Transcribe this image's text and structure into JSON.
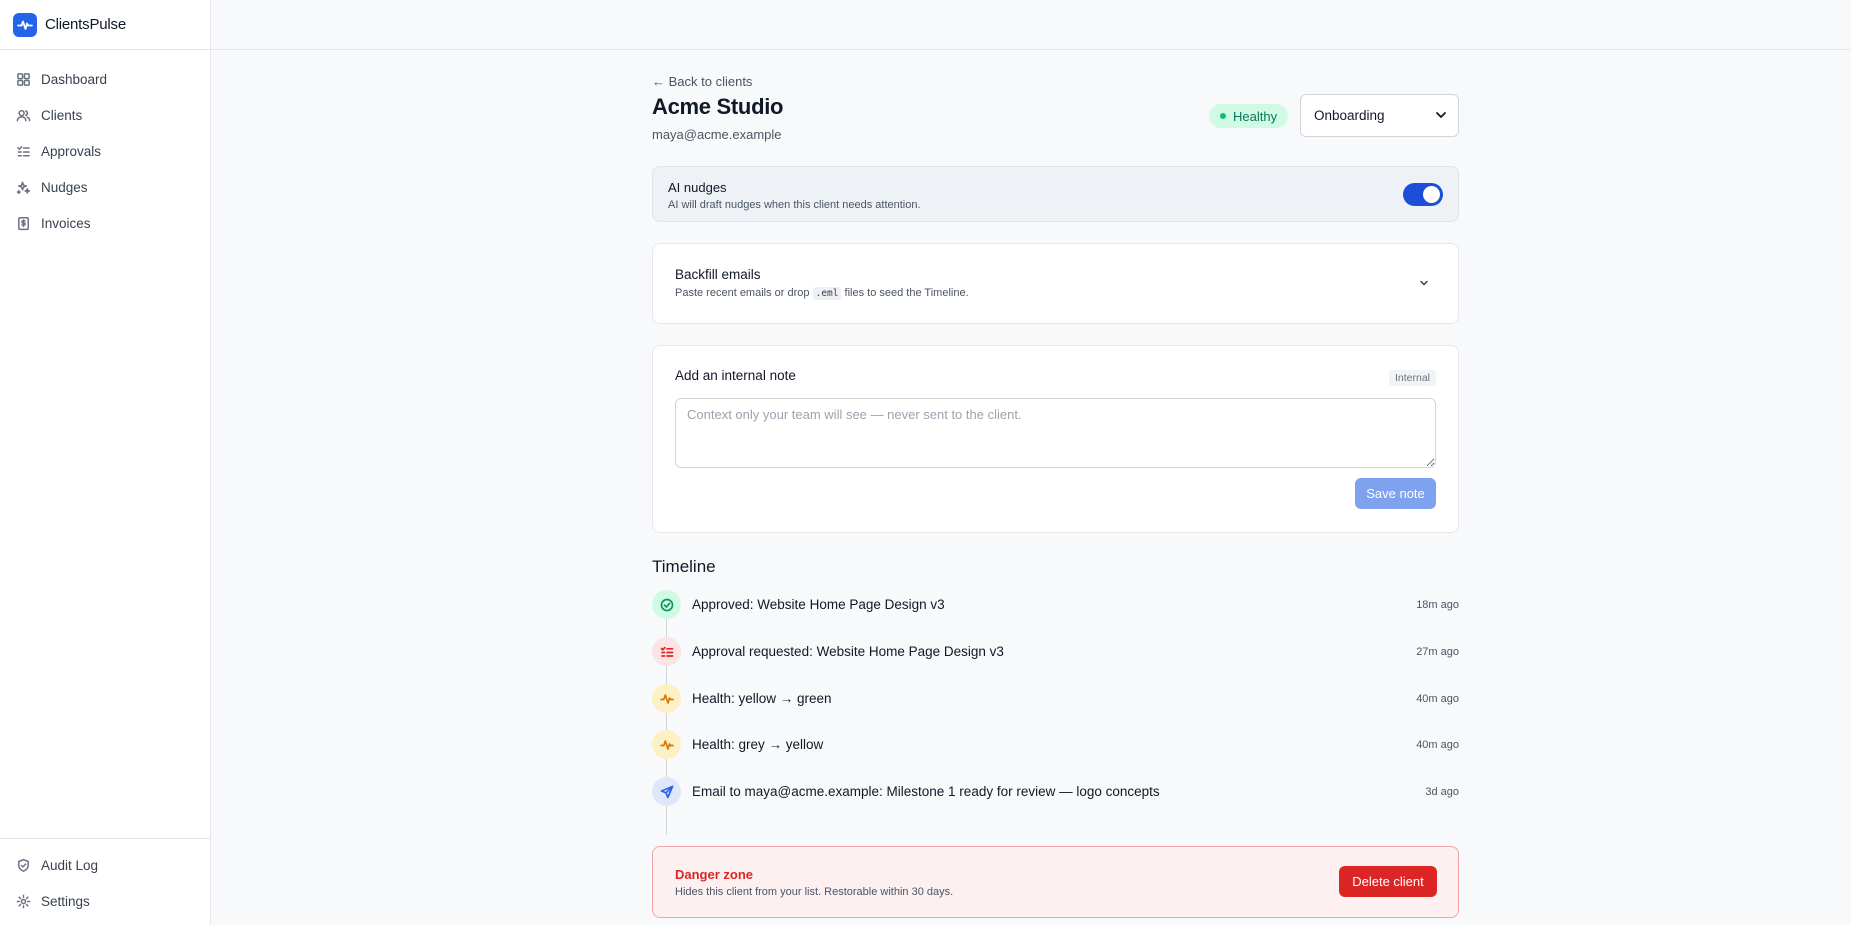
{
  "app": {
    "name": "ClientsPulse",
    "logo_icon": "pulse-icon",
    "brand_color": "#2563eb"
  },
  "sidebar": {
    "items": [
      {
        "label": "Dashboard",
        "icon": "dashboard-icon"
      },
      {
        "label": "Clients",
        "icon": "users-icon"
      },
      {
        "label": "Approvals",
        "icon": "checklist-icon"
      },
      {
        "label": "Nudges",
        "icon": "sparkles-icon"
      },
      {
        "label": "Invoices",
        "icon": "receipt-icon"
      }
    ],
    "bottom_items": [
      {
        "label": "Audit Log",
        "icon": "shield-icon"
      },
      {
        "label": "Settings",
        "icon": "gear-icon"
      }
    ]
  },
  "client": {
    "back_label": "← Back to clients",
    "name": "Acme Studio",
    "email": "maya@acme.example",
    "health_badge": "Healthy",
    "health_color": "#10b981",
    "stage": "Onboarding"
  },
  "ai_nudges": {
    "title": "AI nudges",
    "description": "AI will draft nudges when this client needs attention.",
    "enabled": true
  },
  "backfill": {
    "title": "Backfill emails",
    "description_before": "Paste recent emails or drop ",
    "description_code": ".eml",
    "description_after": " files to seed the Timeline."
  },
  "note": {
    "title": "Add an internal note",
    "badge": "Internal",
    "placeholder": "Context only your team will see — never sent to the client.",
    "save_label": "Save note"
  },
  "timeline": {
    "title": "Timeline",
    "items": [
      {
        "text": "Approved: Website Home Page Design v3",
        "time": "18m ago",
        "icon": "check-circle-icon"
      },
      {
        "text": "Approval requested: Website Home Page Design v3",
        "time": "27m ago",
        "icon": "checklist-icon"
      },
      {
        "text": "Health: yellow → green",
        "time": "40m ago",
        "icon": "activity-icon"
      },
      {
        "text": "Health: grey → yellow",
        "time": "40m ago",
        "icon": "activity-icon"
      },
      {
        "text": "Email to maya@acme.example: Milestone 1 ready for review — logo concepts",
        "time": "3d ago",
        "icon": "send-icon"
      }
    ]
  },
  "danger_zone": {
    "title": "Danger zone",
    "description": "Hides this client from your list. Restorable within 30 days.",
    "delete_label": "Delete client",
    "accent": "#dc2626"
  }
}
